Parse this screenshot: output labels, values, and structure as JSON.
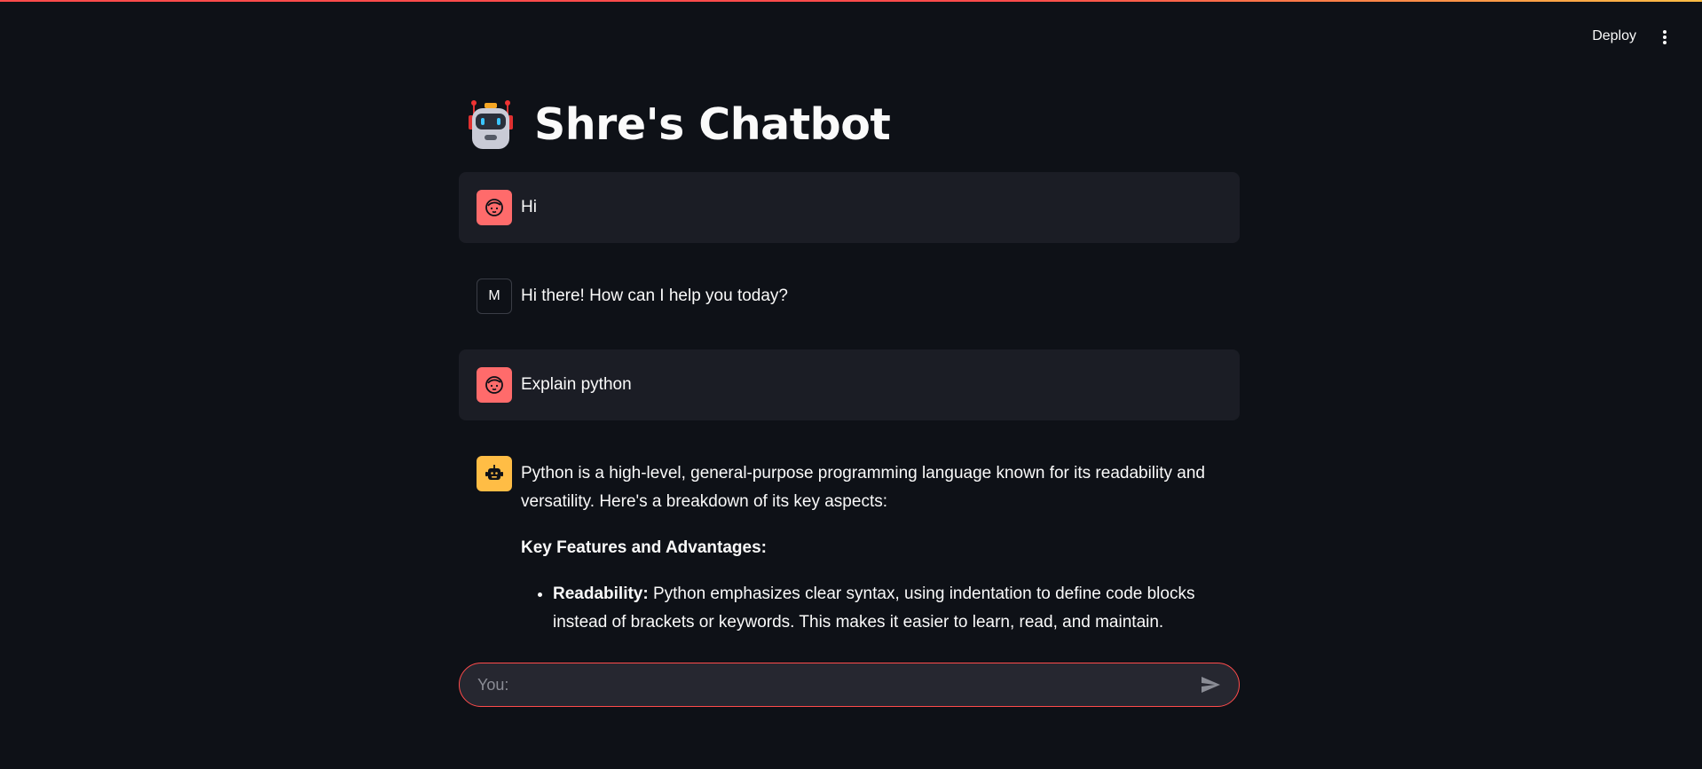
{
  "header": {
    "deploy_label": "Deploy",
    "menu_icon": "kebab-menu-icon"
  },
  "page": {
    "title": "Shre's Chatbot",
    "title_icon": "robot-emoji-icon"
  },
  "messages": [
    {
      "role": "user",
      "avatar": "user-face-icon",
      "text": "Hi"
    },
    {
      "role": "model",
      "avatar_letter": "M",
      "text": "Hi there! How can I help you today?"
    },
    {
      "role": "user",
      "avatar": "user-face-icon",
      "text": "Explain python"
    },
    {
      "role": "assistant",
      "avatar": "bot-face-icon",
      "intro": "Python is a high-level, general-purpose programming language known for its readability and versatility. Here's a breakdown of its key aspects:",
      "section_heading": "Key Features and Advantages:",
      "bullets": [
        {
          "term": "Readability:",
          "desc": " Python emphasizes clear syntax, using indentation to define code blocks instead of brackets or keywords. This makes it easier to learn, read, and maintain."
        }
      ]
    }
  ],
  "input": {
    "placeholder": "You:",
    "value": "",
    "send_icon": "send-arrow-icon"
  },
  "colors": {
    "background": "#0e1117",
    "user_bubble": "#1b1d25",
    "accent": "#ff4b4b",
    "user_avatar": "#ff6b6b",
    "bot_avatar": "#ffbd45"
  }
}
